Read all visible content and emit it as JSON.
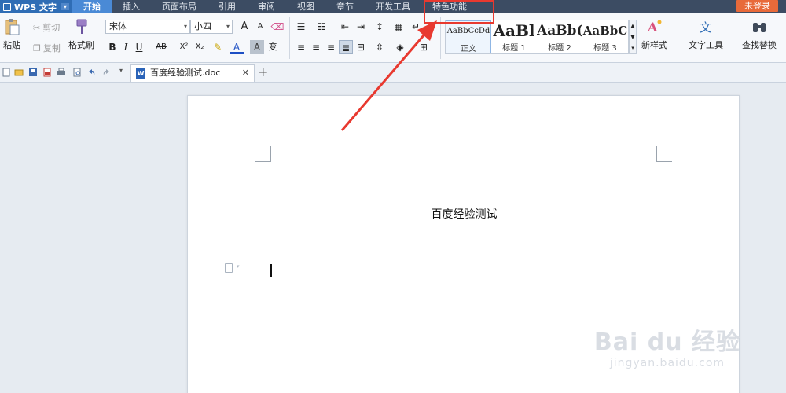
{
  "app": {
    "name": "WPS 文字",
    "menu_arrow": "▾"
  },
  "menu": {
    "items": [
      "开始",
      "插入",
      "页面布局",
      "引用",
      "审阅",
      "视图",
      "章节",
      "开发工具",
      "特色功能"
    ],
    "active_index": 0,
    "login_label": "未登录"
  },
  "ribbon": {
    "clipboard": {
      "paste": "粘贴",
      "cut": "剪切",
      "copy": "复制",
      "format_painter": "格式刷"
    },
    "font": {
      "family": "宋体",
      "size": "小四",
      "bold": "B",
      "italic": "I",
      "underline": "U",
      "strike": "AB",
      "superscript": "X²",
      "subscript": "X₂",
      "font_color_glyph": "A",
      "char_shade_glyph": "A",
      "phonetic_glyph": "变",
      "grow_glyph": "A",
      "shrink_glyph": "A"
    },
    "styles": [
      {
        "preview": "AaBbCcDd",
        "name": "正文"
      },
      {
        "preview": "AaBl",
        "name": "标题 1"
      },
      {
        "preview": "AaBb(",
        "name": "标题 2"
      },
      {
        "preview": "AaBbC",
        "name": "标题 3"
      }
    ],
    "new_style": "新样式",
    "text_tools": "文字工具",
    "find_replace": "查找替换"
  },
  "tabs": {
    "doc_title": "百度经验测试.doc",
    "doc_icon": "W",
    "close_glyph": "✕",
    "add_glyph": "+"
  },
  "document": {
    "body_text": "百度经验测试"
  },
  "watermark": {
    "main": "Bai du 经验",
    "url": "jingyan.baidu.com"
  },
  "colors": {
    "menubar": "#3c4c63",
    "accent": "#4a8ad6",
    "login": "#e86a3a",
    "annotation": "#e8392f"
  }
}
